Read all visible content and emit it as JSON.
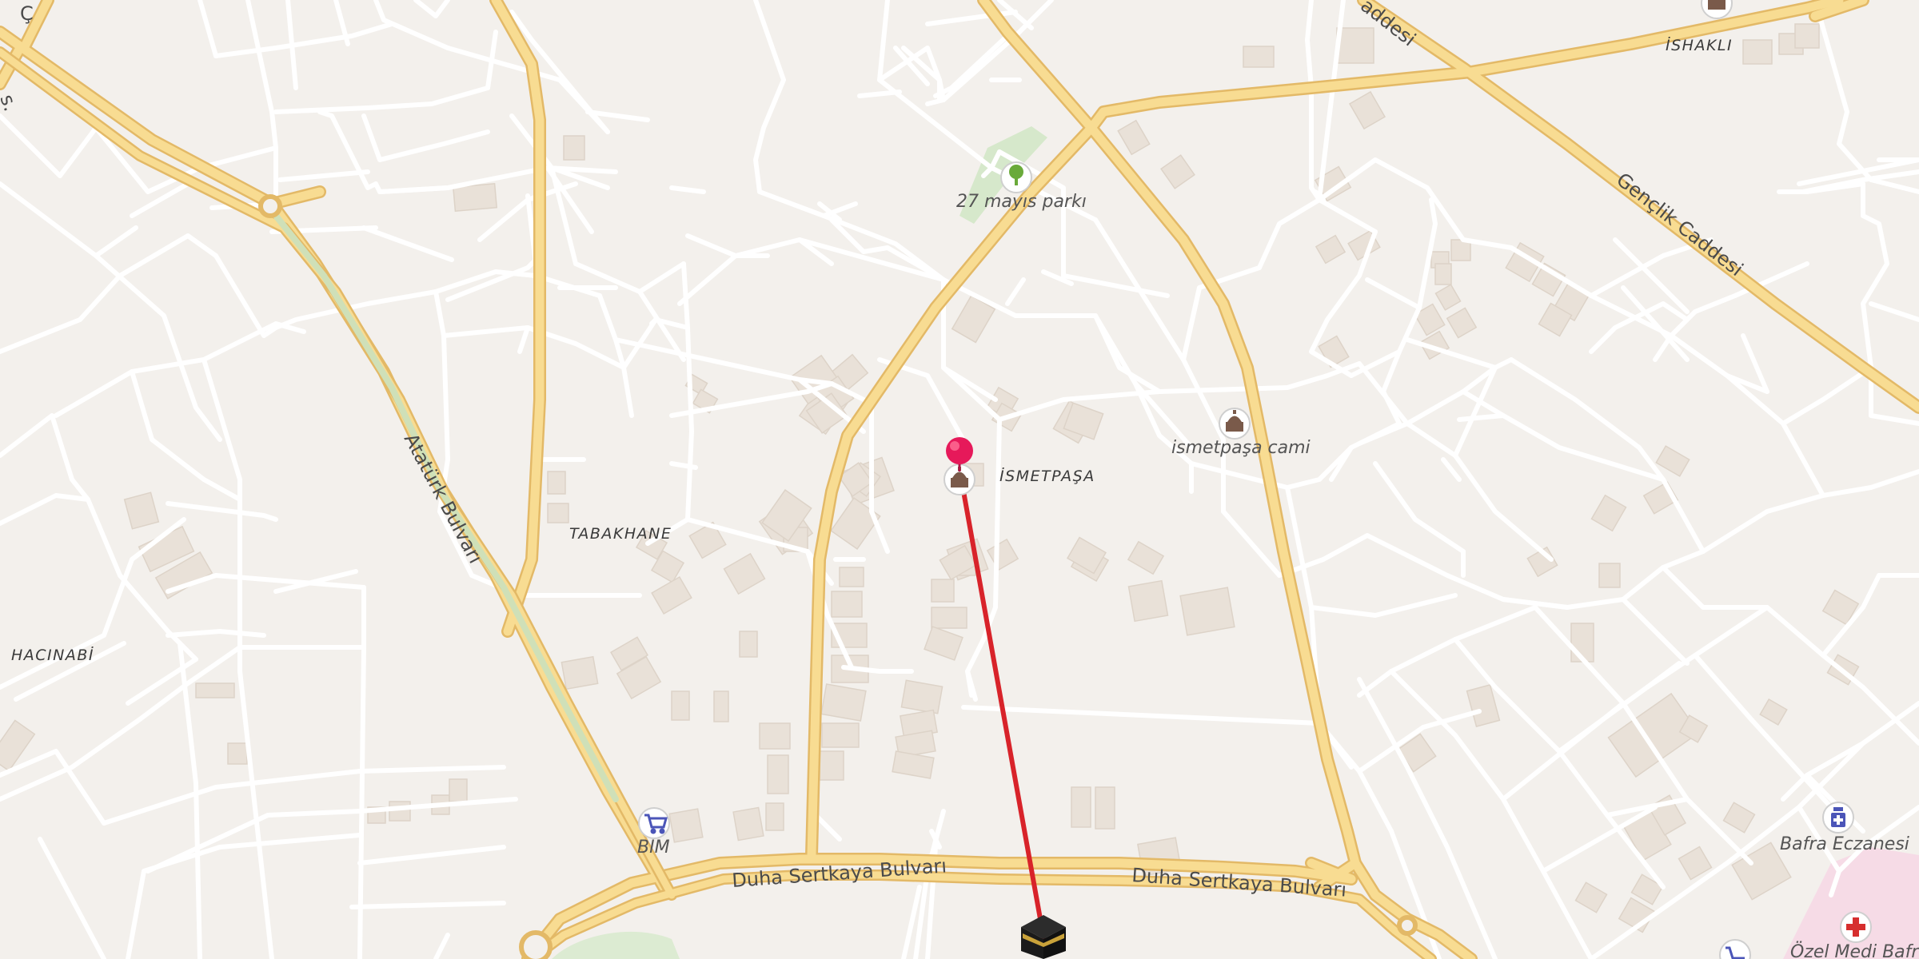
{
  "map": {
    "neighborhoods": [
      {
        "id": "ismetpasa",
        "label": "İSMETPAŞA"
      },
      {
        "id": "tabakhane",
        "label": "TABAKHANE"
      },
      {
        "id": "hacinabi",
        "label": "HACINABİ"
      },
      {
        "id": "ishakli",
        "label": "İSHAKLI"
      }
    ],
    "streets": [
      {
        "id": "ataturk",
        "label": "Atatürk Bulvarı"
      },
      {
        "id": "duha1",
        "label": "Duha Sertkaya Bulvarı"
      },
      {
        "id": "duha2",
        "label": "Duha Sertkaya Bulvarı"
      },
      {
        "id": "genclik",
        "label": "Gençlik Caddesi"
      },
      {
        "id": "caddesi-top",
        "label": "addesi"
      },
      {
        "id": "edge-top",
        "label": "Ç"
      },
      {
        "id": "edge-left",
        "label": "s."
      }
    ],
    "pois": [
      {
        "id": "park",
        "label": "27 mayıs parkı",
        "icon": "tree-icon"
      },
      {
        "id": "cami",
        "label": "ismetpaşa cami",
        "icon": "mosque-icon"
      },
      {
        "id": "bim",
        "label": "BİM",
        "icon": "shopping-cart-icon"
      },
      {
        "id": "eczane",
        "label": "Bafra Eczanesi",
        "icon": "pharmacy-icon"
      },
      {
        "id": "hospital",
        "label": "Özel Medi Bafra",
        "icon": "hospital-cross-icon"
      }
    ],
    "markers": {
      "location_pin": "location-pin-icon",
      "kaaba": "kaaba-icon",
      "mosque_under_pin": "mosque-icon"
    },
    "colors": {
      "background": "#f3f0ec",
      "major_road": "#f7d98c",
      "major_road_casing": "#e7be6a",
      "minor_road": "#ffffff",
      "building": "#e9e2da",
      "park": "#cfe6c2",
      "qibla_line": "#d8232a",
      "pin": "#e6195a"
    }
  }
}
